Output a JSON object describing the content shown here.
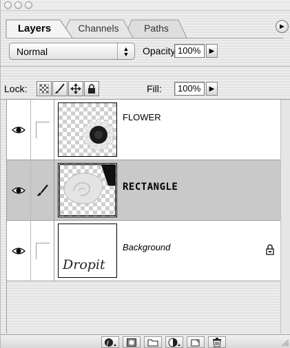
{
  "window": {
    "buttons": [
      "close",
      "minimize",
      "zoom"
    ]
  },
  "tabs": [
    {
      "label": "Layers",
      "active": true
    },
    {
      "label": "Channels",
      "active": false
    },
    {
      "label": "Paths",
      "active": false
    }
  ],
  "controls": {
    "blend_mode": "Normal",
    "opacity_label": "Opacity:",
    "opacity_value": "100%",
    "lock_label": "Lock:",
    "fill_label": "Fill:",
    "fill_value": "100%"
  },
  "layers": [
    {
      "name": "FLOWER",
      "visible": true,
      "linked_icon": "none",
      "selected": false,
      "locked": false,
      "thumbnail": "flower"
    },
    {
      "name": "RECTANGLE",
      "visible": true,
      "linked_icon": "brush",
      "selected": true,
      "locked": false,
      "thumbnail": "shell"
    },
    {
      "name": "Background",
      "visible": true,
      "linked_icon": "none",
      "selected": false,
      "locked": true,
      "thumbnail": "signature",
      "thumb_text": "Dropit"
    }
  ],
  "icons": {
    "eye": "eye-icon",
    "brush": "brush-icon",
    "lock": "lock-icon",
    "move": "move-icon",
    "panel_menu": "play-icon"
  },
  "toolbar": [
    "layer-style",
    "layer-mask",
    "new-set",
    "adjustment-layer",
    "new-layer",
    "trash"
  ]
}
